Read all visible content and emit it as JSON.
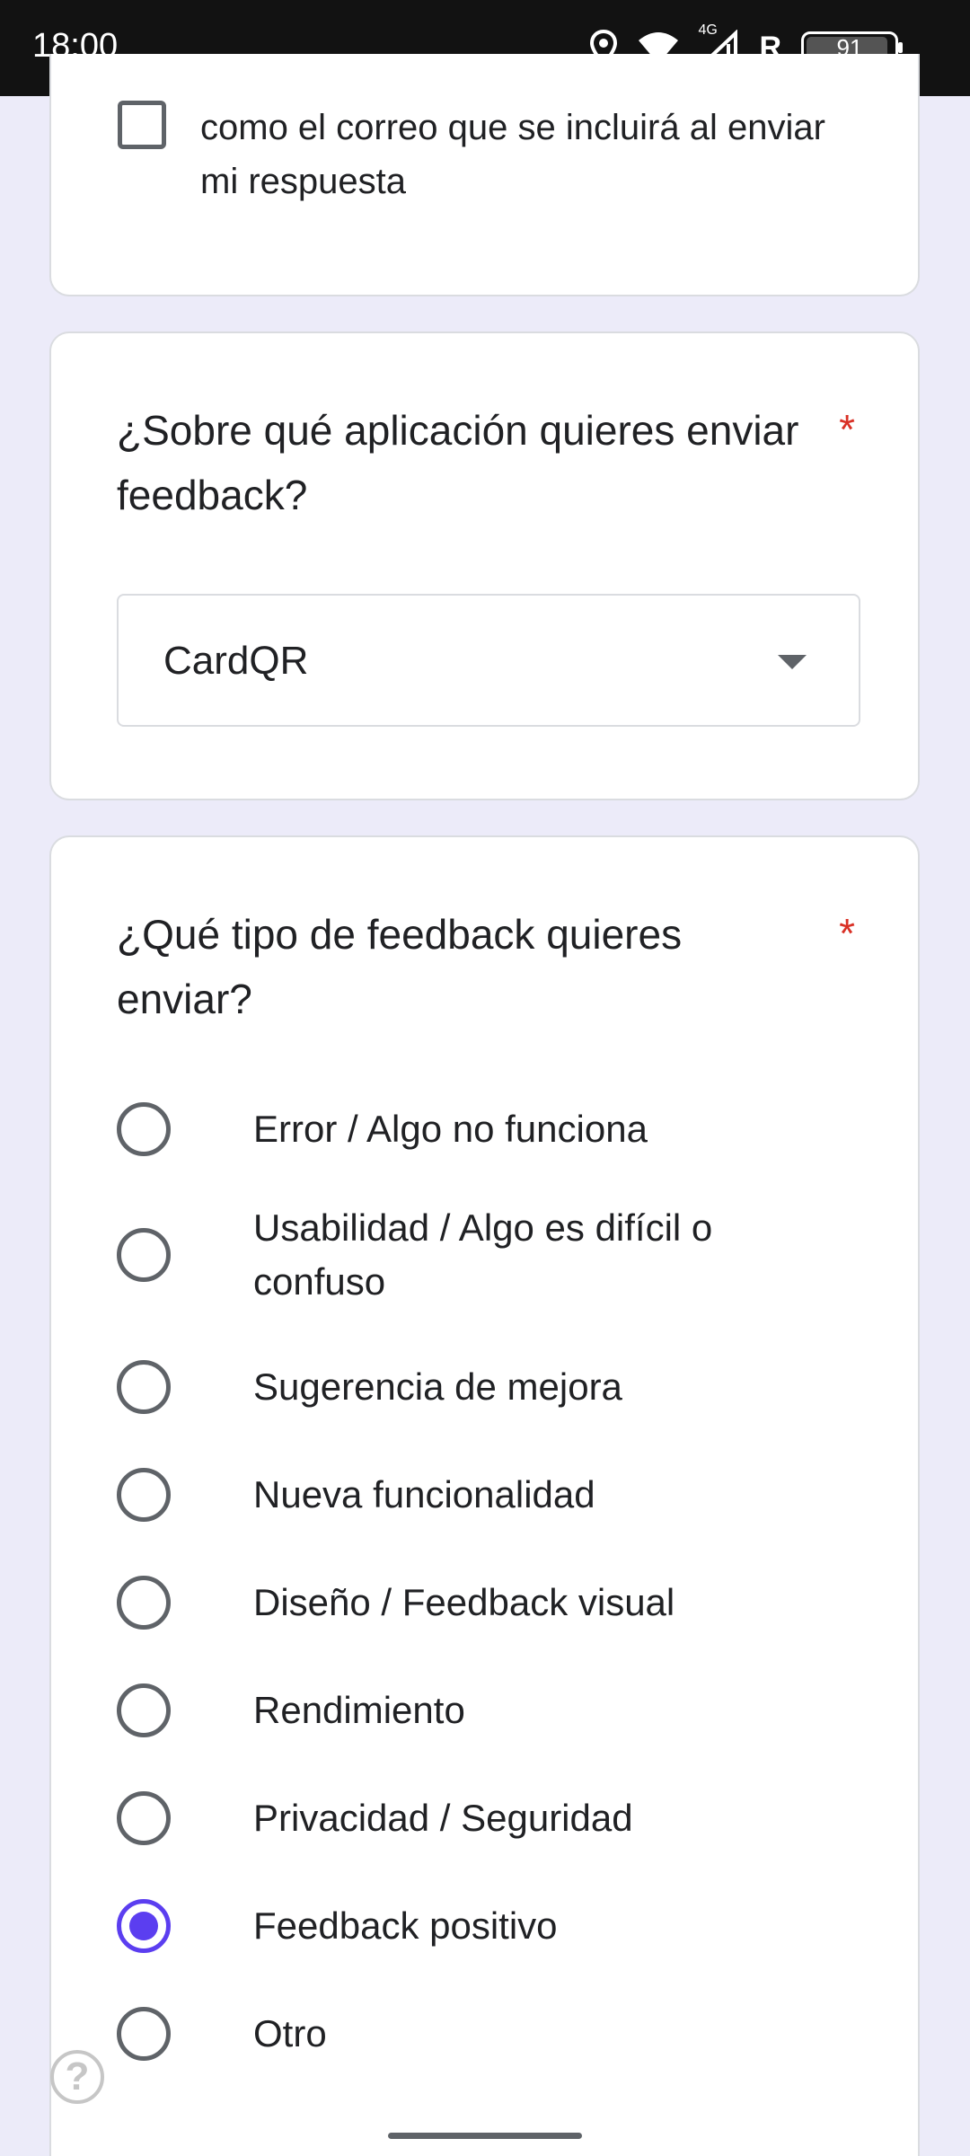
{
  "status_bar": {
    "time": "18:00",
    "network": "4G",
    "roaming": "R",
    "battery": "91"
  },
  "email_card": {
    "checkbox_label": "como el correo que se incluirá al enviar mi respuesta",
    "checked": false
  },
  "app_question": {
    "title": "¿Sobre qué aplicación quieres enviar feedback?",
    "required_mark": "*",
    "selected_value": "CardQR"
  },
  "type_question": {
    "title": "¿Qué tipo de feedback quieres enviar?",
    "required_mark": "*",
    "options": [
      {
        "label": "Error / Algo no funciona",
        "selected": false
      },
      {
        "label": "Usabilidad / Algo es difícil o confuso",
        "selected": false
      },
      {
        "label": "Sugerencia de mejora",
        "selected": false
      },
      {
        "label": "Nueva funcionalidad",
        "selected": false
      },
      {
        "label": "Diseño / Feedback visual",
        "selected": false
      },
      {
        "label": "Rendimiento",
        "selected": false
      },
      {
        "label": "Privacidad / Seguridad",
        "selected": false
      },
      {
        "label": "Feedback positivo",
        "selected": true
      },
      {
        "label": "Otro",
        "selected": false
      }
    ]
  },
  "colors": {
    "accent": "#5b3ef0",
    "required": "#d93025",
    "background": "#ecebf9"
  },
  "help_button": "?"
}
